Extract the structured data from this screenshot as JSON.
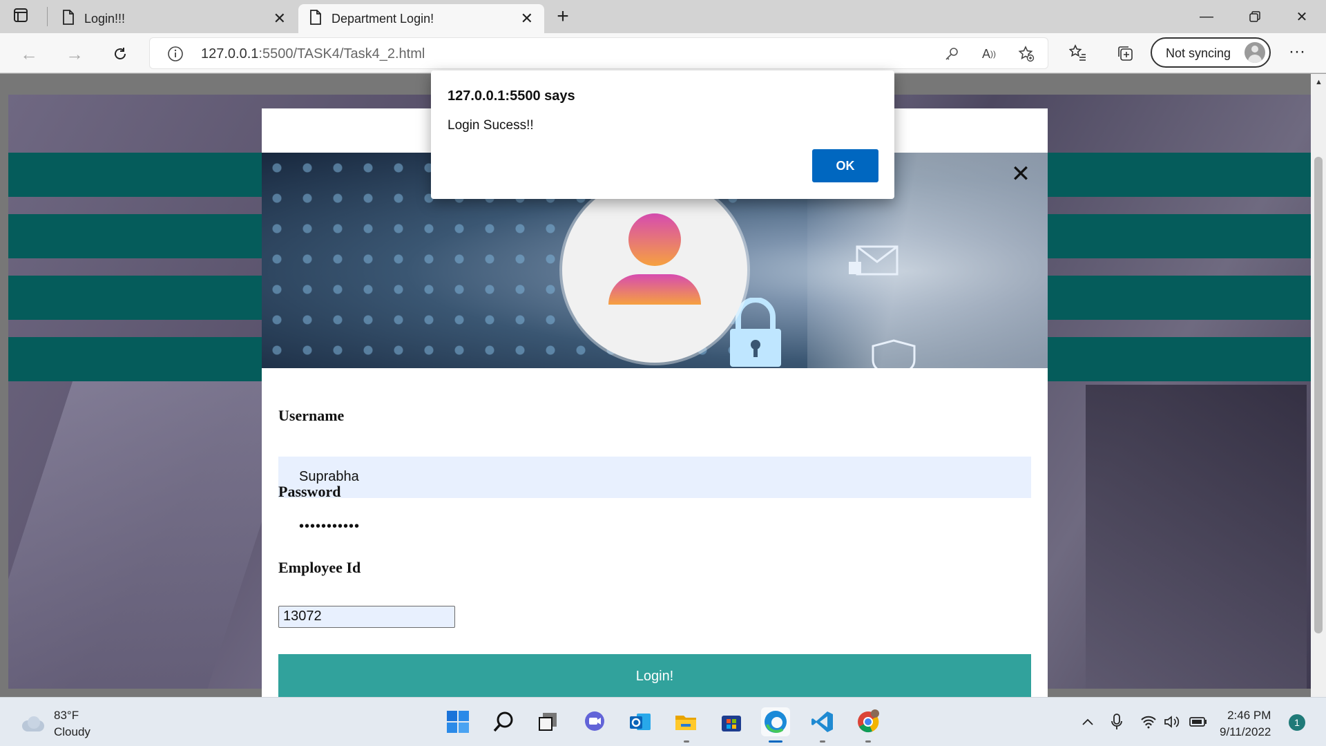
{
  "browser": {
    "tabs": [
      {
        "label": "Login!!!"
      },
      {
        "label": "Department Login!"
      }
    ],
    "url_host": "127.0.0.1",
    "url_path": ":5500/TASK4/Task4_2.html",
    "sync_label": "Not syncing"
  },
  "dialog": {
    "title": "127.0.0.1:5500 says",
    "message": "Login Sucess!!",
    "ok_label": "OK"
  },
  "form": {
    "username_label": "Username",
    "username_value": "Suprabha",
    "password_label": "Password",
    "password_value": "•••••••••••",
    "employee_label": "Employee Id",
    "employee_value": "13072",
    "login_label": "Login!"
  },
  "taskbar": {
    "weather_temp": "83°F",
    "weather_desc": "Cloudy",
    "time": "2:46 PM",
    "date": "9/11/2022",
    "notification_count": "1",
    "apps": [
      "start-icon",
      "search-icon",
      "task-view-icon",
      "teams-chat-icon",
      "outlook-icon",
      "file-explorer-icon",
      "store-icon",
      "edge-icon",
      "vscode-icon",
      "chrome-icon"
    ]
  },
  "colors": {
    "stripe": "#055c5b",
    "login_button": "#31a29c",
    "ok_button": "#0067c0",
    "username_fill": "#e8f0fe"
  }
}
